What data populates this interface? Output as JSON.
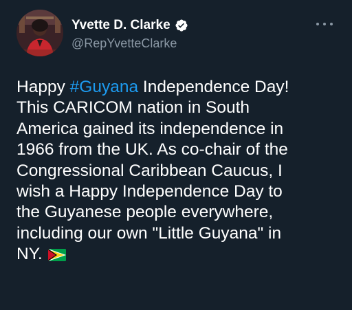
{
  "author": {
    "display_name": "Yvette D. Clarke",
    "handle": "@RepYvetteClarke",
    "verified_icon": "verified-badge-icon",
    "avatar_icon": "avatar-photo"
  },
  "menu": {
    "icon": "more-options-icon"
  },
  "tweet": {
    "line1_pre": "Happy ",
    "hashtag": "#Guyana",
    "line1_post": " Independence Day!",
    "line2": "This CARICOM nation in South",
    "line3": "America gained its independence in",
    "line4": "1966 from the UK. As co-chair of the",
    "line5": "Congressional Caribbean Caucus, I",
    "line6": "wish a Happy Independence Day to",
    "line7": "the Guyanese people everywhere,",
    "line8": "including our own \"Little Guyana\" in",
    "line9": "NY.",
    "emoji_icon": "guyana-flag-icon"
  },
  "colors": {
    "background": "#15202b",
    "text": "#ffffff",
    "secondary_text": "#8b98a5",
    "link": "#1d9bf0",
    "verified": "#ffffff"
  }
}
